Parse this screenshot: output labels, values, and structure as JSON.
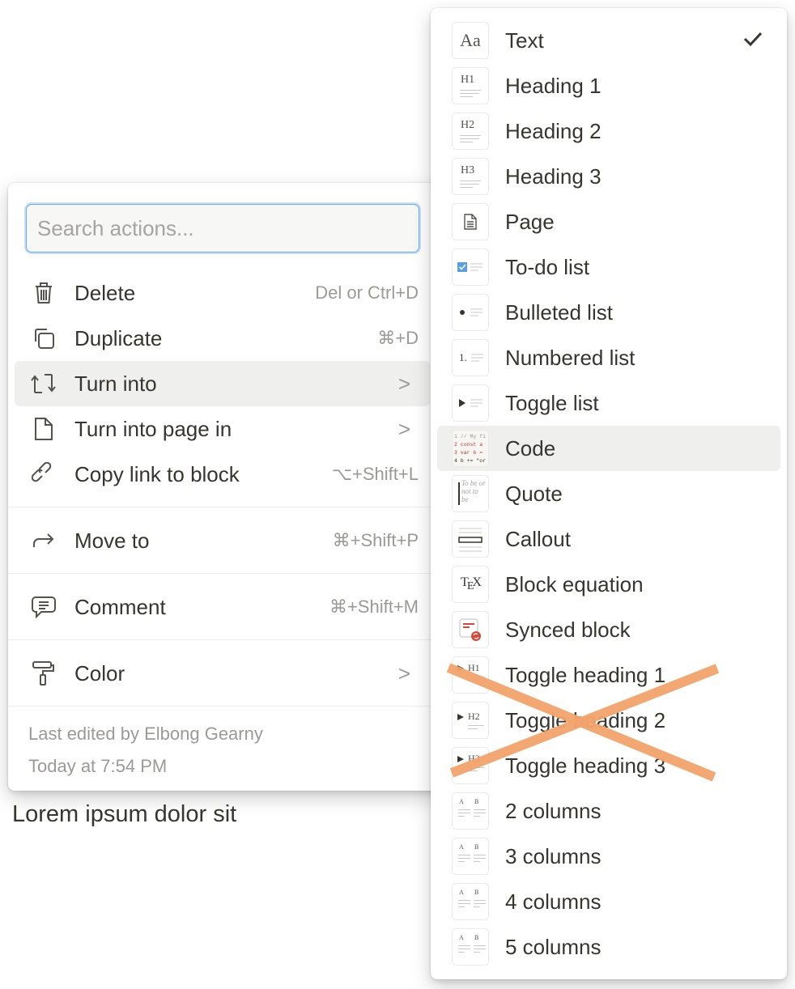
{
  "context_menu": {
    "search": {
      "placeholder": "Search actions...",
      "value": ""
    },
    "items": [
      {
        "label": "Delete",
        "shortcut": "Del or Ctrl+D",
        "icon": "trash-icon"
      },
      {
        "label": "Duplicate",
        "shortcut": "⌘+D",
        "icon": "duplicate-icon"
      },
      {
        "label": "Turn into",
        "shortcut": "",
        "icon": "turn-into-icon",
        "submenu": true,
        "active": true
      },
      {
        "label": "Turn into page in",
        "shortcut": "",
        "icon": "page-icon",
        "submenu": true
      },
      {
        "label": "Copy link to block",
        "shortcut": "⌥+Shift+L",
        "icon": "link-icon"
      },
      {
        "label": "Move to",
        "shortcut": "⌘+Shift+P",
        "icon": "move-arrow-icon"
      },
      {
        "label": "Comment",
        "shortcut": "⌘+Shift+M",
        "icon": "comment-icon"
      },
      {
        "label": "Color",
        "shortcut": "",
        "icon": "paint-roller-icon",
        "submenu": true
      }
    ],
    "chevron": ">",
    "footer": {
      "last_edited": "Last edited by Elbong Gearny",
      "timestamp": "Today at 7:54 PM"
    }
  },
  "page_text": "Lorem ipsum dolor sit",
  "turn_into_menu": {
    "items": [
      {
        "label": "Text",
        "checked": true
      },
      {
        "label": "Heading 1"
      },
      {
        "label": "Heading 2"
      },
      {
        "label": "Heading 3"
      },
      {
        "label": "Page"
      },
      {
        "label": "To-do list"
      },
      {
        "label": "Bulleted list"
      },
      {
        "label": "Numbered list"
      },
      {
        "label": "Toggle list"
      },
      {
        "label": "Code",
        "active": true
      },
      {
        "label": "Quote"
      },
      {
        "label": "Callout"
      },
      {
        "label": "Block equation"
      },
      {
        "label": "Synced block"
      },
      {
        "label": "Toggle heading 1",
        "crossed_out": true
      },
      {
        "label": "Toggle heading 2",
        "crossed_out": true
      },
      {
        "label": "Toggle heading 3",
        "crossed_out": true
      },
      {
        "label": "2 columns"
      },
      {
        "label": "3 columns"
      },
      {
        "label": "4 columns"
      },
      {
        "label": "5 columns"
      }
    ],
    "icon_text": {
      "text": "Aa",
      "h1": "H1",
      "h2": "H2",
      "h3": "H3",
      "numbered": "1.",
      "quote": "To be or not to be",
      "tex": "TeX",
      "col_a": "A",
      "col_b": "B",
      "code_lines": [
        "1 // My fi",
        "2 const a",
        "3 var b =",
        "4 b += \"or"
      ]
    }
  },
  "colors": {
    "accent_blue": "#2383e2",
    "todo_check": "#5aa0e0",
    "synced_red": "#d4493a",
    "cross_out_orange": "#f2a36c",
    "hover_bg": "#efefee"
  }
}
